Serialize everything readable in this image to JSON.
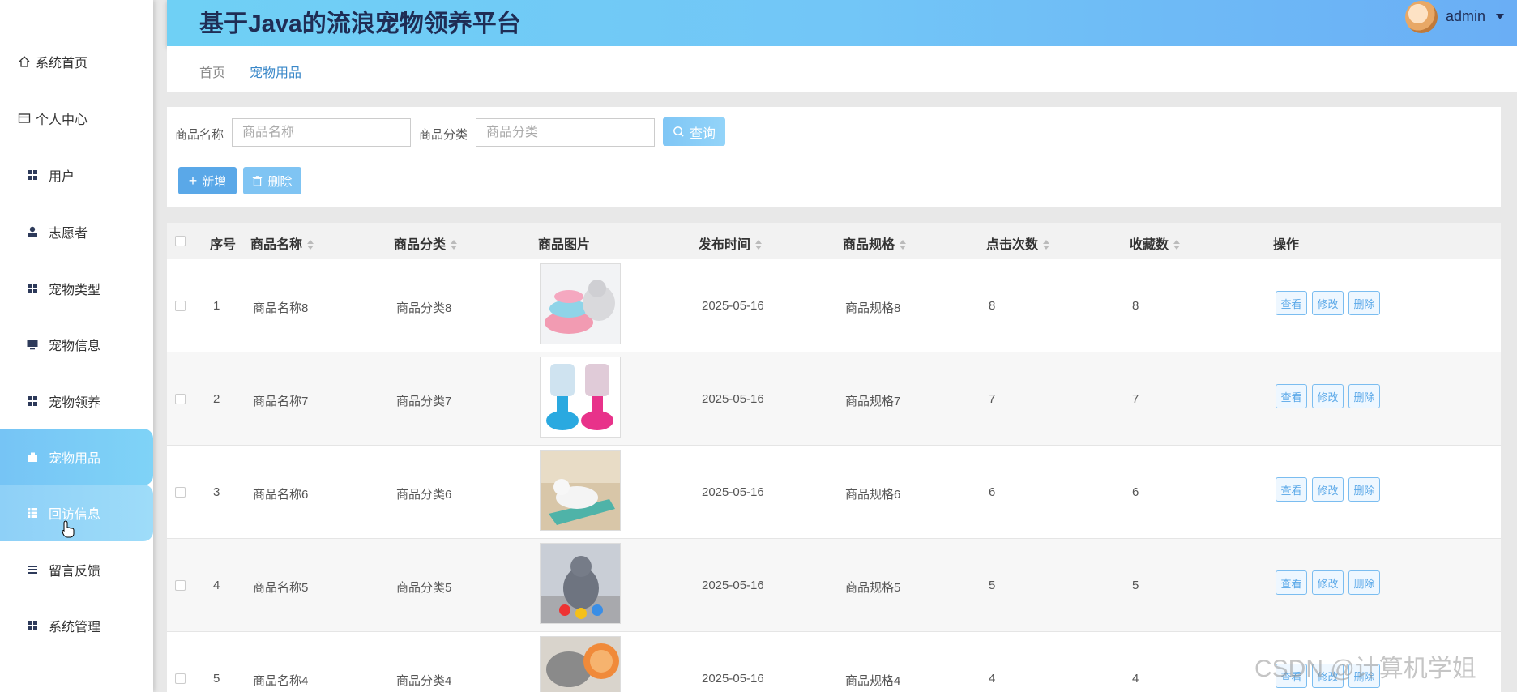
{
  "header": {
    "title": "基于Java的流浪宠物领养平台",
    "user": "admin"
  },
  "sidebar": {
    "items": [
      {
        "label": "系统首页",
        "icon": "home-icon"
      },
      {
        "label": "个人中心",
        "icon": "card-icon"
      },
      {
        "label": "用户",
        "icon": "grid-icon"
      },
      {
        "label": "志愿者",
        "icon": "person-icon"
      },
      {
        "label": "宠物类型",
        "icon": "grid-icon"
      },
      {
        "label": "宠物信息",
        "icon": "monitor-icon"
      },
      {
        "label": "宠物领养",
        "icon": "grid-icon"
      },
      {
        "label": "宠物用品",
        "icon": "gift-icon"
      },
      {
        "label": "回访信息",
        "icon": "table-icon"
      },
      {
        "label": "留言反馈",
        "icon": "list-icon"
      },
      {
        "label": "系统管理",
        "icon": "grid-icon"
      }
    ],
    "active_index": 7
  },
  "breadcrumb": {
    "home": "首页",
    "current": "宠物用品"
  },
  "search": {
    "name_label": "商品名称",
    "name_placeholder": "商品名称",
    "category_label": "商品分类",
    "category_placeholder": "商品分类",
    "query_button": "查询",
    "add_button": "新增",
    "delete_button": "删除"
  },
  "table": {
    "columns": [
      "序号",
      "商品名称",
      "商品分类",
      "商品图片",
      "发布时间",
      "商品规格",
      "点击次数",
      "收藏数",
      "操作"
    ],
    "rows": [
      {
        "index": "1",
        "name": "商品名称8",
        "category": "商品分类8",
        "date": "2025-05-16",
        "spec": "商品规格8",
        "clicks": "8",
        "favorites": "8"
      },
      {
        "index": "2",
        "name": "商品名称7",
        "category": "商品分类7",
        "date": "2025-05-16",
        "spec": "商品规格7",
        "clicks": "7",
        "favorites": "7"
      },
      {
        "index": "3",
        "name": "商品名称6",
        "category": "商品分类6",
        "date": "2025-05-16",
        "spec": "商品规格6",
        "clicks": "6",
        "favorites": "6"
      },
      {
        "index": "4",
        "name": "商品名称5",
        "category": "商品分类5",
        "date": "2025-05-16",
        "spec": "商品规格5",
        "clicks": "5",
        "favorites": "5"
      },
      {
        "index": "5",
        "name": "商品名称4",
        "category": "商品分类4",
        "date": "2025-05-16",
        "spec": "商品规格4",
        "clicks": "4",
        "favorites": "4"
      }
    ],
    "actions": {
      "view": "查看",
      "edit": "修改",
      "delete": "删除"
    }
  },
  "watermark": "CSDN @计算机学姐",
  "colors": {
    "header_start": "#6fd0f5",
    "header_end": "#6aaef5",
    "accent": "#5aa8e8",
    "title": "#1f2d55"
  }
}
